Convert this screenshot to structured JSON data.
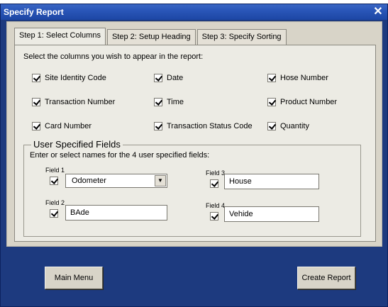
{
  "window": {
    "title": "Specify Report"
  },
  "tabs": [
    {
      "label": "Step 1: Select Columns",
      "active": true
    },
    {
      "label": "Step 2: Setup Heading",
      "active": false
    },
    {
      "label": "Step 3: Specify Sorting",
      "active": false
    }
  ],
  "instruction": "Select the columns you wish to appear in the report:",
  "columns": [
    {
      "label": "Site Identity Code",
      "checked": true
    },
    {
      "label": "Date",
      "checked": true
    },
    {
      "label": "Hose Number",
      "checked": true
    },
    {
      "label": "Transaction Number",
      "checked": true
    },
    {
      "label": "Time",
      "checked": true
    },
    {
      "label": "Product Number",
      "checked": true
    },
    {
      "label": "Card Number",
      "checked": true
    },
    {
      "label": "Transaction Status Code",
      "checked": true
    },
    {
      "label": "Quantity",
      "checked": true
    }
  ],
  "user_fields": {
    "title": "User Specified Fields",
    "instruction": "Enter or select names for the 4 user specified fields:",
    "fields": [
      {
        "label": "Field 1",
        "value": "Odometer",
        "checked": true
      },
      {
        "label": "Field 2",
        "value": "BAde",
        "checked": true
      },
      {
        "label": "Field 3",
        "value": "House",
        "checked": true
      },
      {
        "label": "Field 4",
        "value": "Vehide",
        "checked": true
      }
    ]
  },
  "buttons": {
    "main_menu": "Main Menu",
    "create_report": "Create Report"
  },
  "icons": {
    "close": "close-icon",
    "dropdown": "chevron-down-icon"
  },
  "colors": {
    "title_bar": "#2a56b8",
    "window_bg": "#1d3a7f",
    "panel_bg": "#d8d4c8",
    "tab_page_bg": "#ecebe4"
  }
}
